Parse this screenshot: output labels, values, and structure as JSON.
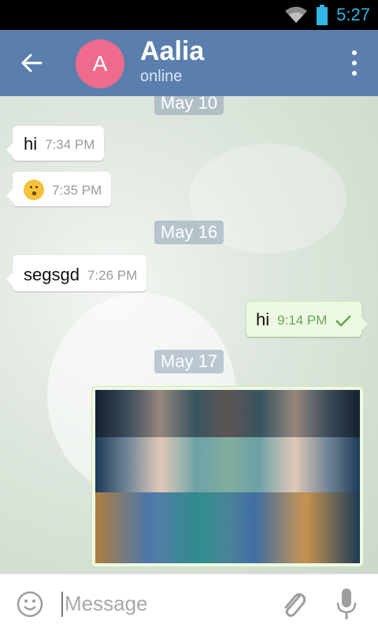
{
  "status_bar": {
    "time": "5:27"
  },
  "header": {
    "avatar_letter": "A",
    "contact_name": "Aalia",
    "contact_status": "online",
    "accent_color": "#5b7fad",
    "avatar_color": "#ef6b8d"
  },
  "messages": {
    "date1": "May 10",
    "m1_text": "hi",
    "m1_time": "7:34 PM",
    "m2_time": "7:35 PM",
    "date2": "May 16",
    "m3_text": "segsgd",
    "m3_time": "7:26 PM",
    "m4_text": "hi",
    "m4_time": "9:14 PM",
    "date3": "May 17"
  },
  "composer": {
    "placeholder": "Message"
  }
}
